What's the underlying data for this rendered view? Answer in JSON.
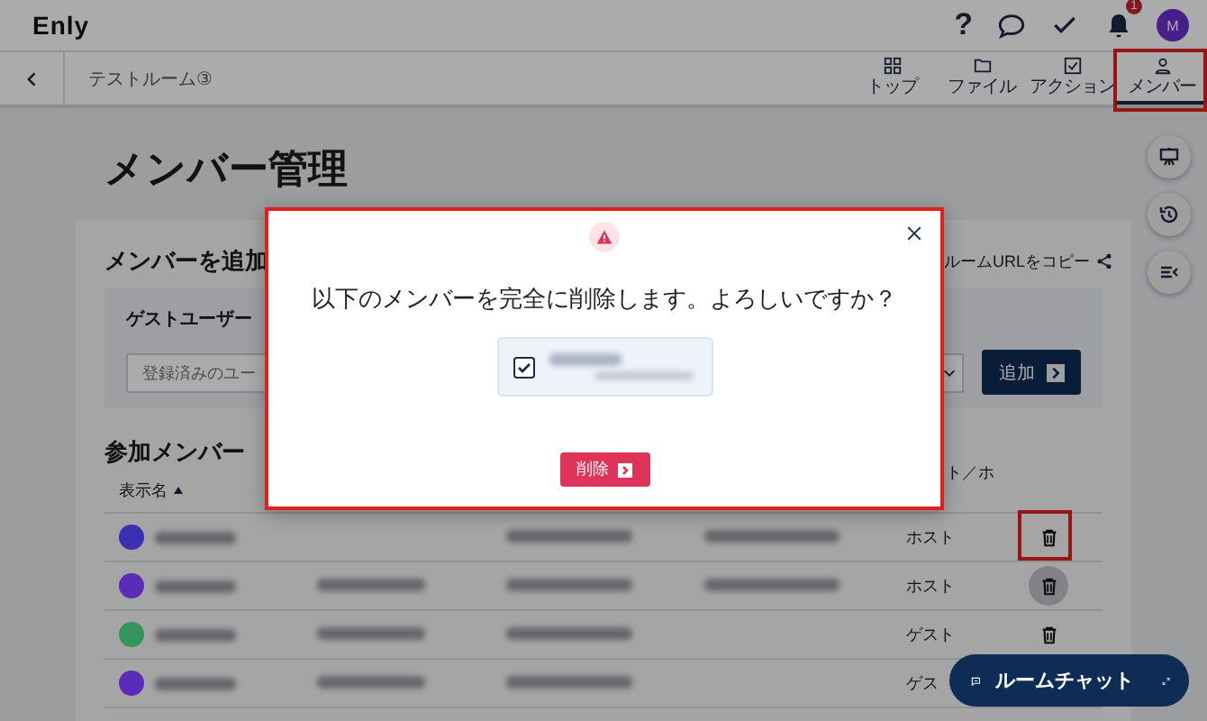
{
  "app": {
    "logo": "Enly",
    "help": "?",
    "notification_count": "1",
    "avatar_initial": "M"
  },
  "room": {
    "title": "テストルーム③"
  },
  "nav_tabs": [
    {
      "label": "トップ",
      "kind": "grid",
      "selected": false,
      "annotated": false
    },
    {
      "label": "ファイル",
      "kind": "folder",
      "selected": false,
      "annotated": false
    },
    {
      "label": "アクション",
      "kind": "check",
      "selected": false,
      "annotated": false
    },
    {
      "label": "メンバー",
      "kind": "person",
      "selected": true,
      "annotated": true
    }
  ],
  "page": {
    "title": "メンバー管理"
  },
  "add_member": {
    "title": "メンバーを追加",
    "copy_link": "ルームURLをコピー",
    "guest_title": "ゲストユーザー",
    "placeholder": "登録済みのユー",
    "add_button": "追加"
  },
  "members": {
    "title": "参加メンバー",
    "columns": [
      "表示名",
      "ト／ホ"
    ],
    "rows": [
      {
        "color": "#3b30b0",
        "role": "ホスト",
        "has_full_name": false,
        "has_tenant": true,
        "hovered": false,
        "annotated": true
      },
      {
        "color": "#5a2cb8",
        "role": "ホスト",
        "has_full_name": true,
        "has_tenant": true,
        "hovered": true,
        "annotated": false
      },
      {
        "color": "#33955a",
        "role": "ゲスト",
        "has_full_name": true,
        "has_tenant": false,
        "hovered": false,
        "annotated": false
      },
      {
        "color": "#5a2cb8",
        "role": "ゲス",
        "has_full_name": true,
        "has_tenant": false,
        "annotated": false
      }
    ]
  },
  "dialog": {
    "message": "以下のメンバーを完全に削除します。よろしいですか？",
    "member_checked": true,
    "delete_button": "削除",
    "annotated": true
  },
  "chat_button": {
    "label": "ルームチャット"
  }
}
